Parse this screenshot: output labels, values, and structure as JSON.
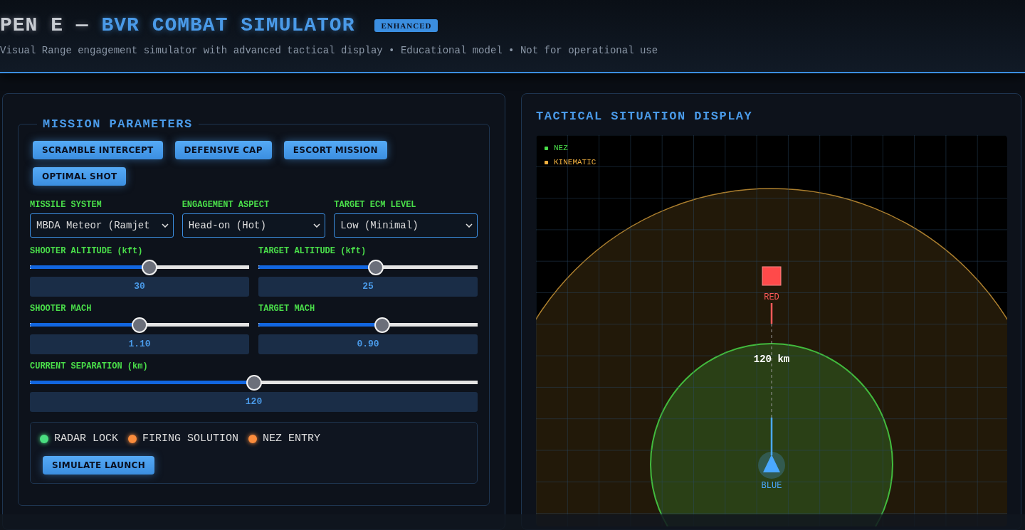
{
  "header": {
    "title_prefix": "PEN E — ",
    "title": "BVR COMBAT SIMULATOR",
    "badge": "ENHANCED",
    "subtitle": "Visual Range engagement simulator with advanced tactical display • Educational model • Not for operational use"
  },
  "mission_parameters": {
    "legend": "MISSION PARAMETERS",
    "presets": [
      "SCRAMBLE INTERCEPT",
      "DEFENSIVE CAP",
      "ESCORT MISSION",
      "OPTIMAL SHOT"
    ],
    "selects": [
      {
        "label": "MISSILE SYSTEM",
        "value": "MBDA Meteor (Ramjet"
      },
      {
        "label": "ENGAGEMENT ASPECT",
        "value": "Head-on (Hot)"
      },
      {
        "label": "TARGET ECM LEVEL",
        "value": "Low (Minimal)"
      }
    ],
    "sliders": [
      {
        "kind": "half",
        "label": "SHOOTER ALTITUDE (kft)",
        "level": 0.55,
        "reading": "30"
      },
      {
        "kind": "half",
        "label": "TARGET ALTITUDE (kft)",
        "level": 0.54,
        "reading": "25"
      },
      {
        "kind": "half",
        "label": "SHOOTER MACH",
        "level": 0.5,
        "reading": "1.10"
      },
      {
        "kind": "half",
        "label": "TARGET MACH",
        "level": 0.57,
        "reading": "0.90"
      },
      {
        "kind": "full",
        "label": "CURRENT SEPARATION (km)",
        "level": 0.5,
        "reading": "120"
      }
    ],
    "status_lights": [
      {
        "label": "RADAR LOCK",
        "color": "#4ade80"
      },
      {
        "label": "FIRING SOLUTION",
        "color": "#fb8c3c"
      },
      {
        "label": "NEZ ENTRY",
        "color": "#fb8c3c"
      }
    ],
    "launch_button": "SIMULATE LAUNCH"
  },
  "tactical_display": {
    "title": "TACTICAL SITUATION DISPLAY",
    "legend": [
      {
        "label": "NEZ",
        "color": "#4ade4a"
      },
      {
        "label": "KINEMATIC",
        "color": "#f0b040"
      }
    ],
    "red_label": "RED",
    "range_label": "120 km",
    "blue_label": "BLUE"
  }
}
